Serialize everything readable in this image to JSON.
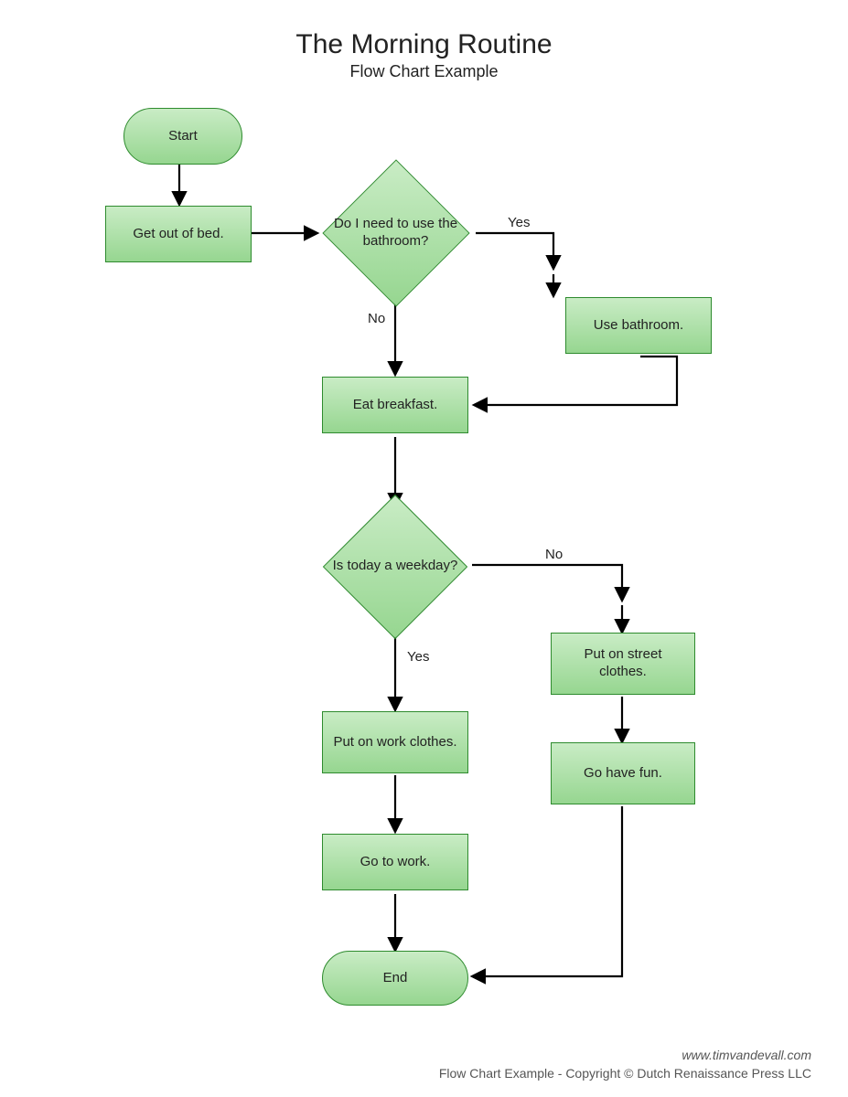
{
  "header": {
    "title": "The Morning Routine",
    "subtitle": "Flow Chart Example"
  },
  "nodes": {
    "start": "Start",
    "get_out_of_bed": "Get out of bed.",
    "bathroom_q": "Do I need to use the bathroom?",
    "use_bathroom": "Use bathroom.",
    "eat_breakfast": "Eat breakfast.",
    "weekday_q": "Is today a weekday?",
    "street_clothes": "Put on street clothes.",
    "have_fun": "Go have fun.",
    "work_clothes": "Put on work clothes.",
    "go_to_work": "Go to work.",
    "end": "End"
  },
  "edge_labels": {
    "bathroom_yes": "Yes",
    "bathroom_no": "No",
    "weekday_yes": "Yes",
    "weekday_no": "No"
  },
  "footer": {
    "url": "www.timvandevall.com",
    "copy": "Flow Chart Example - Copyright © Dutch Renaissance Press LLC"
  }
}
